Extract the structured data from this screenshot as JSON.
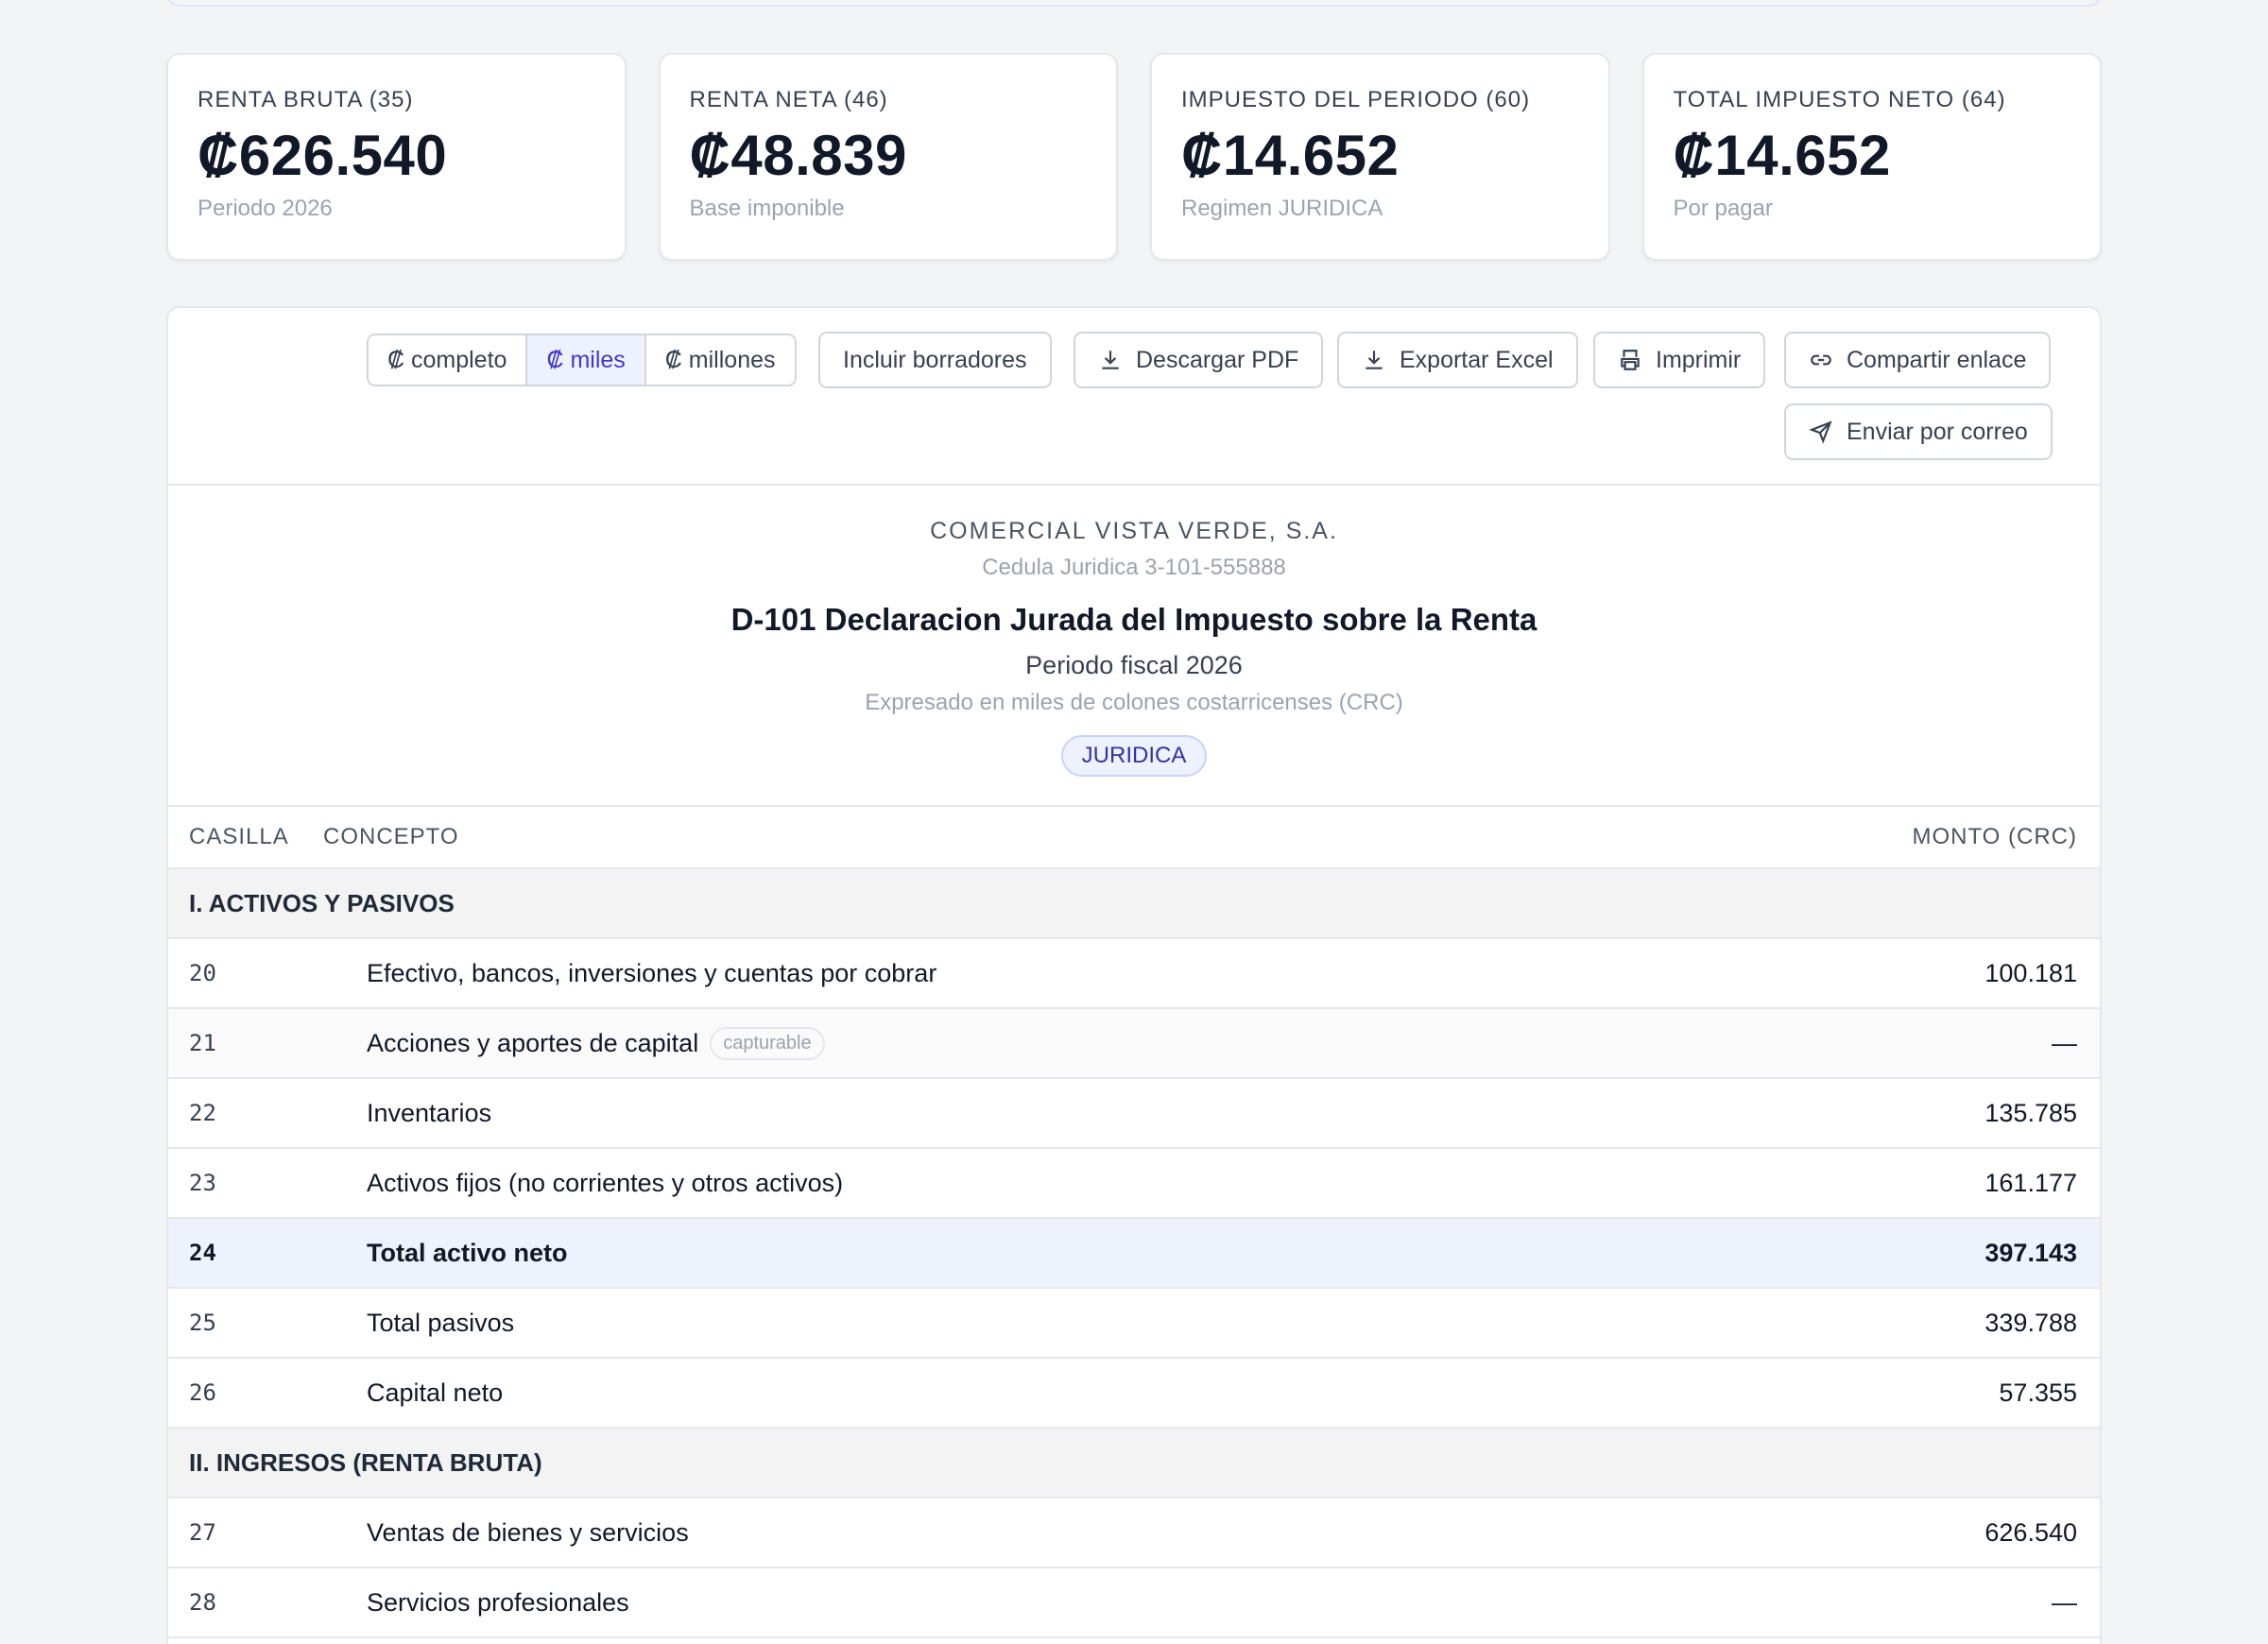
{
  "kpis": [
    {
      "label": "RENTA BRUTA (35)",
      "value": "₡626.540",
      "sub": "Periodo 2026"
    },
    {
      "label": "RENTA NETA (46)",
      "value": "₡48.839",
      "sub": "Base imponible"
    },
    {
      "label": "IMPUESTO DEL PERIODO (60)",
      "value": "₡14.652",
      "sub": "Regimen JURIDICA"
    },
    {
      "label": "TOTAL IMPUESTO NETO (64)",
      "value": "₡14.652",
      "sub": "Por pagar"
    }
  ],
  "toolbar": {
    "scale": [
      "₡ completo",
      "₡ miles",
      "₡ millones"
    ],
    "scale_selected": "₡ miles",
    "include_drafts": "Incluir borradores",
    "download_pdf": "Descargar PDF",
    "export_excel": "Exportar Excel",
    "print": "Imprimir",
    "share_link": "Compartir enlace",
    "send_email": "Enviar por correo"
  },
  "report": {
    "company": "COMERCIAL VISTA VERDE, S.A.",
    "cedula": "Cedula Juridica 3-101-555888",
    "title": "D-101 Declaracion Jurada del Impuesto sobre la Renta",
    "periodo": "Periodo fiscal 2026",
    "expresado": "Expresado en miles de colones costarricenses (CRC)",
    "regime_badge": "JURIDICA"
  },
  "table": {
    "headers": {
      "casilla": "CASILLA",
      "concepto": "CONCEPTO",
      "monto": "MONTO (CRC)"
    },
    "sections": [
      {
        "title": "I. ACTIVOS Y PASIVOS",
        "rows": [
          {
            "casilla": "20",
            "concepto": "Efectivo, bancos, inversiones y cuentas por cobrar",
            "monto": "100.181"
          },
          {
            "casilla": "21",
            "concepto": "Acciones y aportes de capital",
            "tag": "capturable",
            "monto": "—"
          },
          {
            "casilla": "22",
            "concepto": "Inventarios",
            "monto": "135.785"
          },
          {
            "casilla": "23",
            "concepto": "Activos fijos (no corrientes y otros activos)",
            "monto": "161.177"
          },
          {
            "casilla": "24",
            "concepto": "Total activo neto",
            "monto": "397.143",
            "total": true
          },
          {
            "casilla": "25",
            "concepto": "Total pasivos",
            "monto": "339.788"
          },
          {
            "casilla": "26",
            "concepto": "Capital neto",
            "monto": "57.355"
          }
        ]
      },
      {
        "title": "II. INGRESOS (RENTA BRUTA)",
        "rows": [
          {
            "casilla": "27",
            "concepto": "Ventas de bienes y servicios",
            "monto": "626.540"
          },
          {
            "casilla": "28",
            "concepto": "Servicios profesionales",
            "monto": "—"
          }
        ]
      }
    ]
  }
}
